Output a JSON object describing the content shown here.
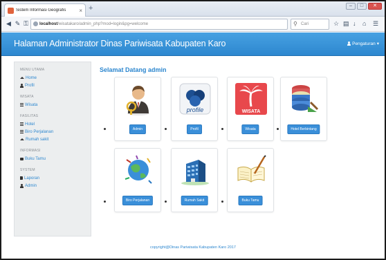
{
  "browser": {
    "tab_title": "Sistem Informasi Geografis",
    "tab_close": "×",
    "new_tab": "+",
    "url_host": "localhost",
    "url_path": "/wisatakaro/admin_php?mod=login&pg=welcome",
    "reload_glyph": "C",
    "search_placeholder": "Cari",
    "window_minimize": "–",
    "window_maximize": "□",
    "window_close": "✕"
  },
  "header": {
    "title": "Halaman Administrator Dinas Pariwisata Kabupaten Karo",
    "settings_label": "Pengaturan",
    "settings_caret": "▾"
  },
  "sidebar": {
    "sections": [
      {
        "title": "MENU UTAMA",
        "items": [
          {
            "label": "Home",
            "icon": "home-icon"
          },
          {
            "label": "Profil",
            "icon": "user-icon"
          }
        ]
      },
      {
        "title": "WISATA",
        "items": [
          {
            "label": "Wisata",
            "icon": "list-icon"
          }
        ]
      },
      {
        "title": "FASILITAS",
        "items": [
          {
            "label": "Hotel",
            "icon": "list-icon"
          },
          {
            "label": "Biro Perjalanan",
            "icon": "list-icon"
          },
          {
            "label": "Rumah sakit",
            "icon": "home-icon"
          }
        ]
      },
      {
        "title": "INFORMASI",
        "items": [
          {
            "label": "Buku Tamu",
            "icon": "flag-icon"
          }
        ]
      },
      {
        "title": "SYSTEM",
        "items": [
          {
            "label": "Laporan",
            "icon": "book-icon"
          },
          {
            "label": "Admin",
            "icon": "user-icon"
          }
        ]
      }
    ]
  },
  "main": {
    "welcome": "Selamat Datang admin",
    "cards": [
      {
        "label": "Admin",
        "icon": "admin-person-icon"
      },
      {
        "label": "Profil",
        "icon": "profile-icon"
      },
      {
        "label": "Wisata",
        "icon": "wisata-palm-icon"
      },
      {
        "label": "Hotel Berbintang",
        "icon": "hotel-database-icon"
      },
      {
        "label": "Biro Perjalanan",
        "icon": "travel-globe-icon"
      },
      {
        "label": "Rumah Sakit",
        "icon": "hospital-building-icon"
      },
      {
        "label": "Buku Tamu",
        "icon": "guestbook-icon"
      }
    ],
    "profile_icon_text": "profile",
    "wisata_icon_text": "WISATA"
  },
  "footer": {
    "copyright": "copyright@Dinas Pariwisata Kabupaten Karo 2017"
  },
  "colors": {
    "header_blue": "#2d87cf",
    "button_blue": "#3a8fd9",
    "sidebar_bg": "#eceeef"
  }
}
